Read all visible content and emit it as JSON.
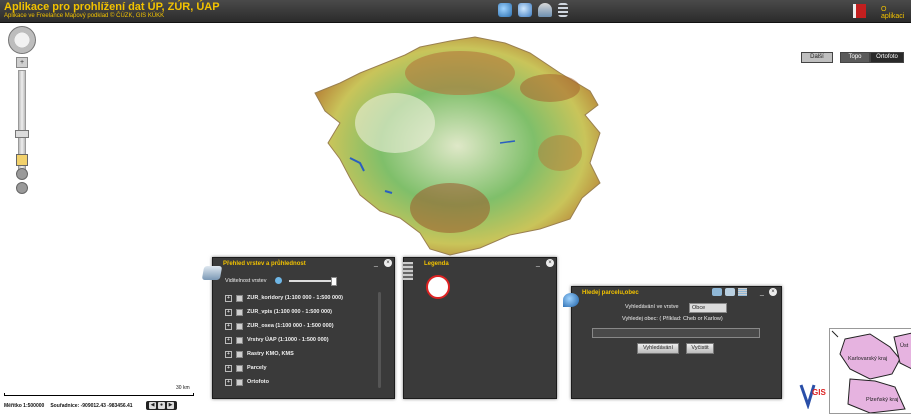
{
  "header": {
    "title": "Aplikace pro prohlížení dat ÚP, ZÚR, ÚAP",
    "subtitle": "Aplikace ve Freelance Mapový podklad © ČÚZK, GIS KÚKK",
    "about_link": "O aplikaci"
  },
  "map_buttons": {
    "more": "Další",
    "topo": "Topo",
    "ortofoto": "Ortofoto"
  },
  "layers_panel": {
    "title": "Přehled vrstev a průhlednost",
    "visibility_label": "Viditelnost vrstev",
    "layers": [
      "ZUR_koridory (1:100 000 - 1:500 000)",
      "ZUR_vpis (1:100 000 - 1:500 000)",
      "ZUR_osea (1:100 000 - 1:500 000)",
      "Vrstvy ÚAP (1:1000 - 1:500 000)",
      "Rastry KMO, KMS",
      "Parcely",
      "Ortofoto"
    ]
  },
  "legend_panel": {
    "title": "Legenda"
  },
  "search_panel": {
    "title": "Hledej parcelu,obec",
    "search_in_label": "Vyhledávání ve vrstve",
    "search_in_value": "Obce",
    "hint": "Vyhledej obec: ( Příklad: Cheb or Karlow)",
    "search_button": "Vyhledávání",
    "clear_button": "Vyčistit"
  },
  "status": {
    "scale_label": "Měřítko 1:500000",
    "coords_label": "Souřadnice: -909012.43 -983456.41",
    "scalebar_label": "30 km"
  },
  "overview": {
    "regions": [
      "Karlovarský kraj",
      "Plzeňský kraj",
      "Úst"
    ]
  },
  "colors": {
    "accent": "#f2c200",
    "panel": "#3a3a3a",
    "header": "#2b2b2b"
  }
}
